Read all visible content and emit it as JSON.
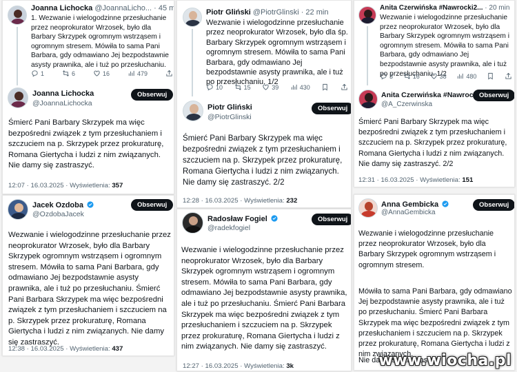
{
  "follow_label": "Obserwuj",
  "views_label": "Wyświetlenia:",
  "col1": {
    "top_tweet": {
      "name": "Joanna Lichocka",
      "handle_time": "@JoannaLicho... · 45 min",
      "text": "1. Wezwanie i wielogodzinne przesłuchanie przez neoprokurator Wrzosek, było dla Barbary Skrzypek ogromnym wstrząsem i ogromnym stresem. Mówiła to sama Pani Barbara, gdy odmawiano Jej bezpodstawnie asysty prawnika, ale i tuż po przesłuchaniu.",
      "replies": "1",
      "reposts": "6",
      "likes": "16",
      "views": "479"
    },
    "main_tweet": {
      "name": "Joanna Lichocka",
      "handle": "@JoannaLichocka",
      "text": "Śmierć Pani Barbary Skrzypek ma więc bezpośredni związek z tym przesłuchaniem i szczuciem na p. Skrzypek przez prokuraturę, Romana Giertycha i ludzi z nim związanych. Nie damy się zastraszyć.",
      "time": "12:07 · 16.03.2025 ·",
      "views": "357"
    },
    "second": {
      "name": "Jacek Ozdoba",
      "handle": "@OzdobaJacek",
      "text": "Wezwanie i wielogodzinne przesłuchanie przez neoprokurator Wrzosek, było dla Barbary Skrzypek ogromnym wstrząsem i ogromnym stresem. Mówiła to sama Pani Barbara, gdy odmawiano Jej bezpodstawnie asysty prawnika, ale i tuż po przesłuchaniu. Śmierć Pani Barbara Skrzypek ma więc bezpośredni związek z tym przesłuchaniem i szczuciem na p. Skrzypek przez prokuraturę, Romana Giertycha i ludzi z nim związanych. Nie damy się zastraszyć.",
      "time": "12:38 · 16.03.2025 ·",
      "views": "437"
    }
  },
  "col2": {
    "top_tweet": {
      "name": "Piotr Gliński",
      "handle_time": "@PiotrGlinski · 22 min",
      "text": "Wezwanie i wielogodzinne przesłuchanie przez neoprokurator Wrzosek, było dla śp. Barbary Skrzypek ogromnym wstrząsem i ogromnym stresem. Mówiła to sama Pani Barbara, gdy odmawiano Jej bezpodstawnie asysty prawnika, ale i tuż po przesłuchaniu. 1/2",
      "replies": "10",
      "reposts": "15",
      "likes": "39",
      "views": "430"
    },
    "main_tweet": {
      "name": "Piotr Gliński",
      "handle": "@PiotrGlinski",
      "text": "Śmierć Pani Barbary Skrzypek ma więc bezpośredni związek z tym przesłuchaniem i szczuciem na p. Skrzypek przez prokuraturę, Romana Giertycha i ludzi z nim związanych. Nie damy się zastraszyć. 2/2",
      "time": "12:28 · 16.03.2025 ·",
      "views": "232"
    },
    "second": {
      "name": "Radosław Fogiel",
      "handle": "@radekfogiel",
      "text": "Wezwanie i wielogodzinne przesłuchanie przez neoprokurator Wrzosek, było dla Barbary Skrzypek ogromnym wstrząsem i ogromnym stresem. Mówiła to sama Pani Barbara, gdy odmawiano Jej bezpodstawnie asysty prawnika, ale i tuż po przesłuchaniu. Śmierć Pani Barbara Skrzypek ma więc bezpośredni związek z tym przesłuchaniem i szczuciem na p. Skrzypek przez prokuraturę, Romana Giertycha i ludzi z nim związanych. Nie damy się zastraszyć.",
      "time": "12:27 · 16.03.2025 ·",
      "views": "3k"
    }
  },
  "col3": {
    "top_tweet": {
      "name": "Anita Czerwińska #Nawrocki2...",
      "handle_time": "· 20 min",
      "text": "Wezwanie i wielogodzinne przesłuchanie przez neoprokurator Wrzosek, było dla Barbary Skrzypek ogromnym wstrząsem i ogromnym stresem. Mówiła to sama Pani Barbara, gdy odmawiano Jej bezpodstawnie asysty prawnika, ale i tuż po przesłuchaniu. 1/2",
      "replies": "3",
      "reposts": "16",
      "likes": "38",
      "views": "480"
    },
    "main_tweet": {
      "name": "Anita Czerwińska #Nawrocki...",
      "handle": "@A_Czerwinska",
      "text": "Śmierć Pani Barbary Skrzypek ma więc bezpośredni związek z tym przesłuchaniem i szczuciem na p. Skrzypek przez prokuraturę, Romana Giertycha i ludzi z nim związanych. Nie damy się zastraszyć. 2/2",
      "time": "12:31 · 16.03.2025 ·",
      "views": "151"
    },
    "second": {
      "name": "Anna Gembicka",
      "handle": "@AnnaGembicka",
      "para1": "Wezwanie i wielogodzinne przesłuchanie przez neoprokurator Wrzosek, było dla Barbary Skrzypek ogromnym wstrząsem i ogromnym stresem.",
      "para2": "Mówiła to sama Pani Barbara, gdy odmawiano Jej bezpodstawnie asysty prawnika, ale i tuż po przesłuchaniu. Śmierć Pani Barbara Skrzypek ma więc bezpośredni związek z tym przesłuchaniem i szczuciem na p. Skrzypek przez prokuraturę, Romana Giertycha i ludzi z nim związanych.",
      "para3": "Nie damy się zastraszyć."
    }
  },
  "watermark": "www.wiocha.pl",
  "colors": {
    "verified": "#1d9bf0",
    "button": "#0f1419",
    "muted": "#536471",
    "thread": "#cfd9de"
  }
}
